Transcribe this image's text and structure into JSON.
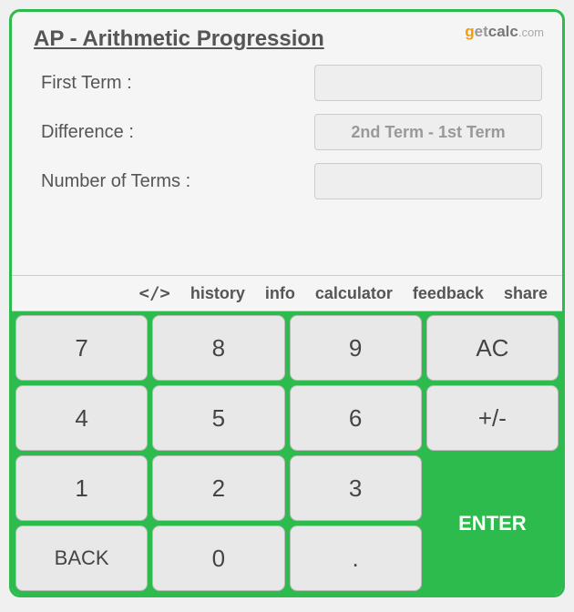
{
  "title": "AP - Arithmetic Progression",
  "logo": {
    "g": "g",
    "et": "et",
    "calc": "calc",
    "com": ".com"
  },
  "fields": {
    "first_term": {
      "label": "First Term :",
      "value": "",
      "placeholder": ""
    },
    "difference": {
      "label": "Difference :",
      "value": "",
      "placeholder": "2nd Term - 1st Term"
    },
    "num_terms": {
      "label": "Number of Terms :",
      "value": "",
      "placeholder": ""
    }
  },
  "tabs": {
    "code": "</>",
    "history": "history",
    "info": "info",
    "calculator": "calculator",
    "feedback": "feedback",
    "share": "share"
  },
  "keys": {
    "k7": "7",
    "k8": "8",
    "k9": "9",
    "ac": "AC",
    "k4": "4",
    "k5": "5",
    "k6": "6",
    "pm": "+/-",
    "k1": "1",
    "k2": "2",
    "k3": "3",
    "enter": "ENTER",
    "back": "BACK",
    "k0": "0",
    "dot": "."
  }
}
